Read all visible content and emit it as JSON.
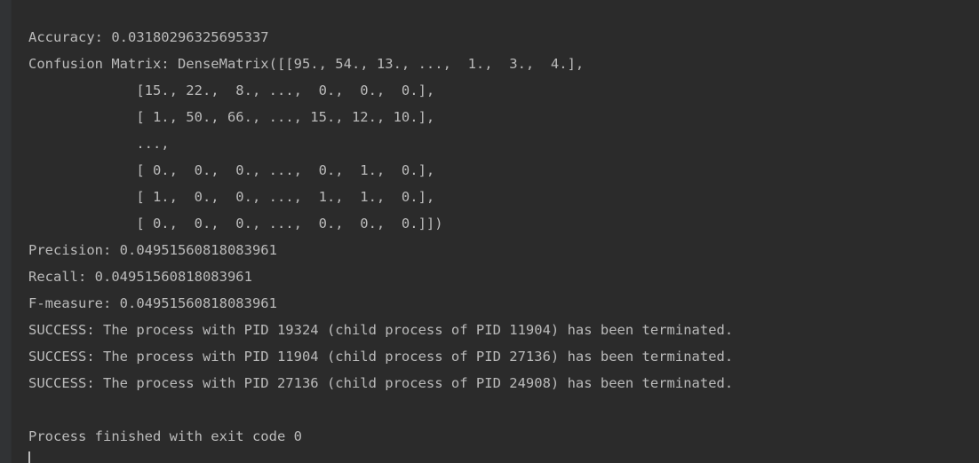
{
  "console": {
    "lines": [
      "Accuracy: 0.03180296325695337",
      "Confusion Matrix: DenseMatrix([[95., 54., 13., ...,  1.,  3.,  4.],",
      "             [15., 22.,  8., ...,  0.,  0.,  0.],",
      "             [ 1., 50., 66., ..., 15., 12., 10.],",
      "             ...,",
      "             [ 0.,  0.,  0., ...,  0.,  1.,  0.],",
      "             [ 1.,  0.,  0., ...,  1.,  1.,  0.],",
      "             [ 0.,  0.,  0., ...,  0.,  0.,  0.]])",
      "Precision: 0.04951560818083961",
      "Recall: 0.04951560818083961",
      "F-measure: 0.04951560818083961",
      "SUCCESS: The process with PID 19324 (child process of PID 11904) has been terminated.",
      "SUCCESS: The process with PID 11904 (child process of PID 27136) has been terminated.",
      "SUCCESS: The process with PID 27136 (child process of PID 24908) has been terminated.",
      "",
      "Process finished with exit code 0"
    ]
  },
  "colors": {
    "background": "#2b2b2b",
    "text": "#bbbbbb"
  }
}
